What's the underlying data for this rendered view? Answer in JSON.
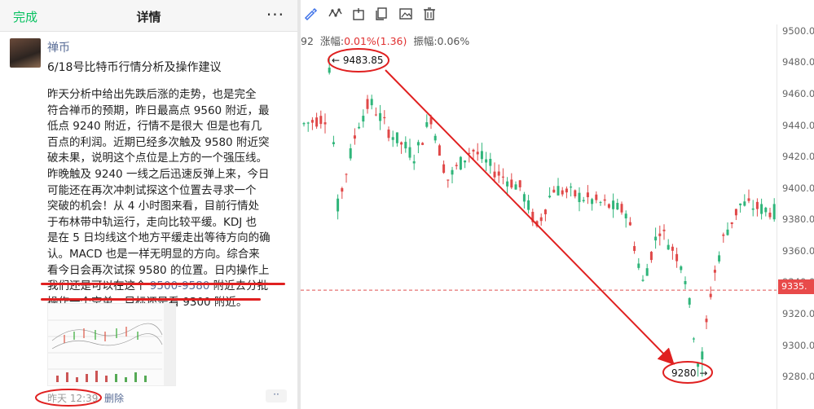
{
  "nav": {
    "done_label": "完成",
    "title": "详情",
    "more_label": "···"
  },
  "post": {
    "author": "禅币",
    "title": "6/18号比特币行情分析及操作建议",
    "body_main": "昨天分析中给出先跌后涨的走势，也是完全\n符合禅币的预期，昨日最高点 9560 附近，最\n低点 9240 附近，行情不是很大 但是也有几\n百点的利润。近期已经多次触及 9580 附近突\n破未果，说明这个点位是上方的一个强压线。\n昨晚触及 9240 一线之后迅速反弹上来，今日\n可能还在再次冲刺试探这个位置去寻求一个\n突破的机会！从 4 小时图来看，目前行情处\n于布林带中轨运行，走向比较平缓。KDJ 也\n是在 5 日均线这个地方平缓走出等待方向的确\n认。MACD 也是一样无明显的方向。综合来\n看今日会再次试探 9580 的位置。日内操作上\n",
    "body_line12_pre": "我们还是可以在这个 ",
    "body_line12_link": "9500-9580",
    "body_line12_post": " 附近去分批",
    "body_line13": "操作一个空单，目标还是看 9300 附近。",
    "time": "昨天 12:39",
    "delete_label": "删除",
    "more_label": "··"
  },
  "chart_toolbar": {
    "icons": [
      "pen-icon",
      "nodes-icon",
      "marker-icon",
      "copy-icon",
      "image-icon",
      "trash-icon"
    ]
  },
  "stats": {
    "left_value": "92",
    "change_label": "涨幅:",
    "change_value": "0.01%(1.36)",
    "amplitude_label": "振幅:",
    "amplitude_value": "0.06%"
  },
  "chart_data": {
    "type": "candlestick",
    "y_ticks": [
      "9500.0",
      "9480.0",
      "9460.0",
      "9440.0",
      "9420.0",
      "9400.0",
      "9380.0",
      "9360.0",
      "9340.0",
      "9320.0",
      "9300.0",
      "9280.0"
    ],
    "ylim": [
      9276,
      9504
    ],
    "current_price": "9335.",
    "current_price_value": 9335,
    "annotation_high": "9483.85",
    "annotation_low": "9280",
    "high_value": 9483.85,
    "low_value": 9280,
    "colors": {
      "up": "#2fb57a",
      "down": "#e04848",
      "price_line": "#e05050",
      "arrow": "#e02020"
    }
  }
}
